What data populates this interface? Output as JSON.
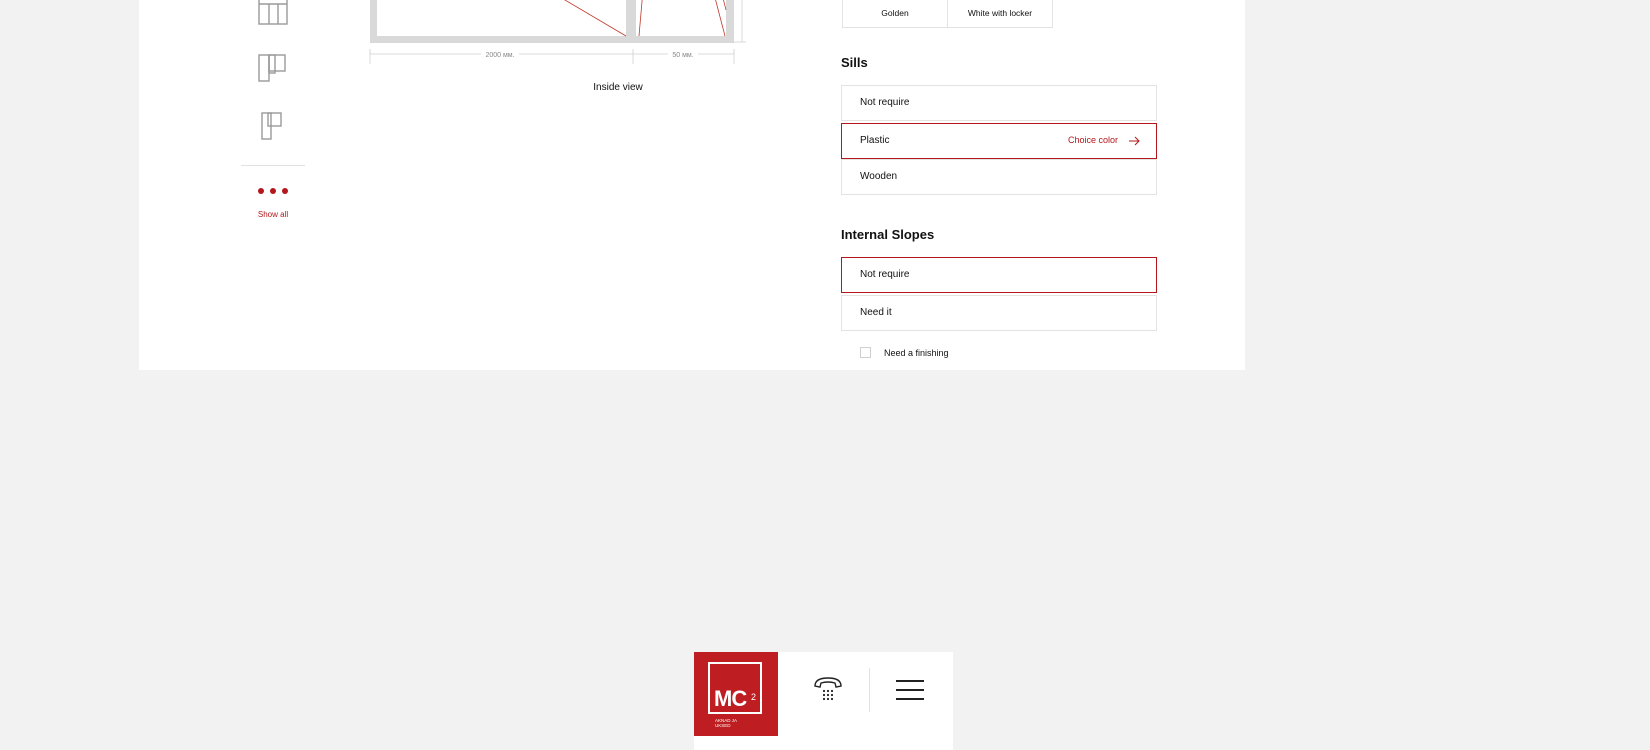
{
  "preview": {
    "dim_main": "2000 мм.",
    "dim_side": "50 мм.",
    "caption": "Inside view"
  },
  "layouts": {
    "show_all": "Show all"
  },
  "colors": {
    "accent": "#b3161b",
    "brand": "#be1e22",
    "background": "#f2f2f2",
    "panel": "#ffffff"
  },
  "handle_colors": [
    {
      "label": "Golden"
    },
    {
      "label": "White with locker"
    }
  ],
  "sills": {
    "title": "Sills",
    "options": [
      {
        "label": "Not require",
        "selected": false
      },
      {
        "label": "Plastic",
        "selected": true,
        "action": "Choice color"
      },
      {
        "label": "Wooden",
        "selected": false
      }
    ]
  },
  "slopes": {
    "title": "Internal Slopes",
    "options": [
      {
        "label": "Not require",
        "selected": true
      },
      {
        "label": "Need it",
        "selected": false
      }
    ],
    "finishing_label": "Need a finishing",
    "finishing_checked": false
  },
  "bottom_bar": {
    "logo_text": "MC",
    "logo_sup": "2",
    "logo_tag_line1": "AKNAD JA",
    "logo_tag_line2": "UKSED"
  },
  "icons": [
    "layout-grid-icon",
    "layout-two-sash-icon",
    "layout-single-sash-icon",
    "more-dots-icon",
    "arrow-right-icon",
    "phone-icon",
    "menu-icon"
  ]
}
